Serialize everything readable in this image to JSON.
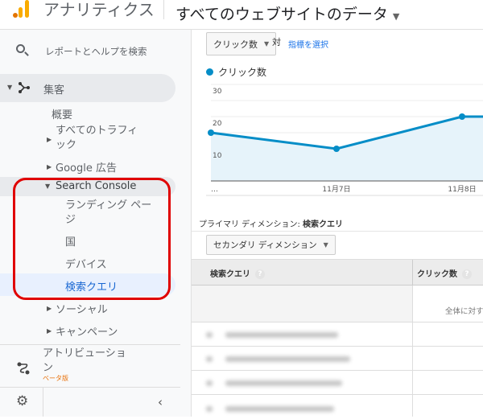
{
  "header": {
    "app_name": "アナリティクス",
    "property": "すべてのウェブサイトのデータ"
  },
  "sidebar": {
    "search_placeholder": "レポートとヘルプを検索",
    "acquisition": "集客",
    "items": [
      {
        "label": "概要"
      },
      {
        "label": "すべてのトラフィ ック"
      },
      {
        "label": "Google 広告"
      },
      {
        "label": "Search Console"
      },
      {
        "label": "ランディング ペー ジ"
      },
      {
        "label": "国"
      },
      {
        "label": "デバイス"
      },
      {
        "label": "検索クエリ",
        "selected": true
      },
      {
        "label": "ソーシャル"
      },
      {
        "label": "キャンペーン"
      }
    ],
    "attribution": "アトリビューション",
    "beta": "ベータ版"
  },
  "metric": {
    "selected": "クリック数",
    "vs": "対",
    "select_metric": "指標を選択"
  },
  "chart_data": {
    "type": "area",
    "legend": "クリック数",
    "x": [
      "…",
      "11月7日",
      "11月8日",
      ""
    ],
    "series": [
      {
        "name": "クリック数",
        "values": [
          15,
          10,
          20,
          20
        ]
      }
    ],
    "yticks": [
      10,
      20,
      30
    ],
    "ylim": [
      0,
      30
    ],
    "grid": true,
    "color": "#058dc7"
  },
  "table": {
    "primary_label": "プライマリ ディメンション:",
    "primary_value": "検索クエリ",
    "secondary_button": "セカンダリ ディメンション",
    "columns": [
      "検索クエリ",
      "クリック数"
    ],
    "summary_text": "全体に対す"
  },
  "colors": {
    "accent": "#1a73e8",
    "highlight": "#e00000",
    "chart": "#058dc7"
  }
}
